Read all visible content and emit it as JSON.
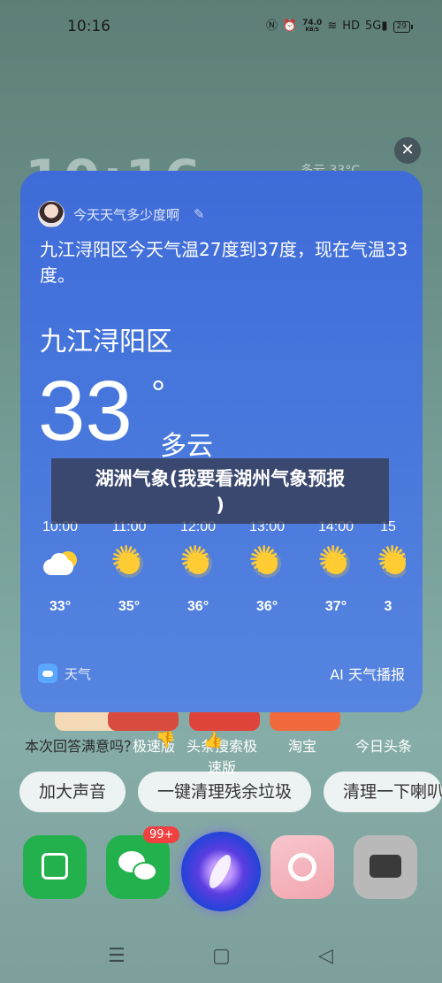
{
  "status_bar": {
    "time": "10:16",
    "net_speed": "74.0",
    "net_unit": "KB/S",
    "signal_label": "5G",
    "battery": "29"
  },
  "background": {
    "clock": "10:16",
    "weather_hint": "多云 33°C"
  },
  "card": {
    "query": "今天天气多少度啊",
    "answer": "九江浔阳区今天气温27度到37度，现在气温33度。",
    "city": "九江浔阳区",
    "temperature": "33",
    "degree_symbol": "°",
    "condition": "多云",
    "hourly": [
      {
        "time": "10:00",
        "temp": "33°",
        "icon": "partly-cloudy-icon"
      },
      {
        "time": "11:00",
        "temp": "35°",
        "icon": "sun-icon"
      },
      {
        "time": "12:00",
        "temp": "36°",
        "icon": "sun-icon"
      },
      {
        "time": "13:00",
        "temp": "36°",
        "icon": "sun-icon"
      },
      {
        "time": "14:00",
        "temp": "37°",
        "icon": "sun-icon"
      },
      {
        "time": "15",
        "temp": "3",
        "icon": "sun-icon"
      }
    ],
    "app_name": "天气",
    "broadcast": "AI 天气播报"
  },
  "overlay_banner": {
    "line1": "湖洲气象(我要看湖州气象预报",
    "line2": ")"
  },
  "feedback_prompt": "本次回答满意吗？",
  "apps_behind": [
    {
      "label": "极速版"
    },
    {
      "label": "头条搜索极速版"
    },
    {
      "label": "淘宝"
    },
    {
      "label": "今日头条"
    }
  ],
  "suggestions": [
    "加大声音",
    "一键清理残余垃圾",
    "清理一下喇叭"
  ],
  "dock": {
    "badge": "99+"
  },
  "colors": {
    "card_top": "#3f6bd8",
    "card_bottom": "#5684e0",
    "sun": "#ffcc33",
    "badge": "#f04040"
  }
}
